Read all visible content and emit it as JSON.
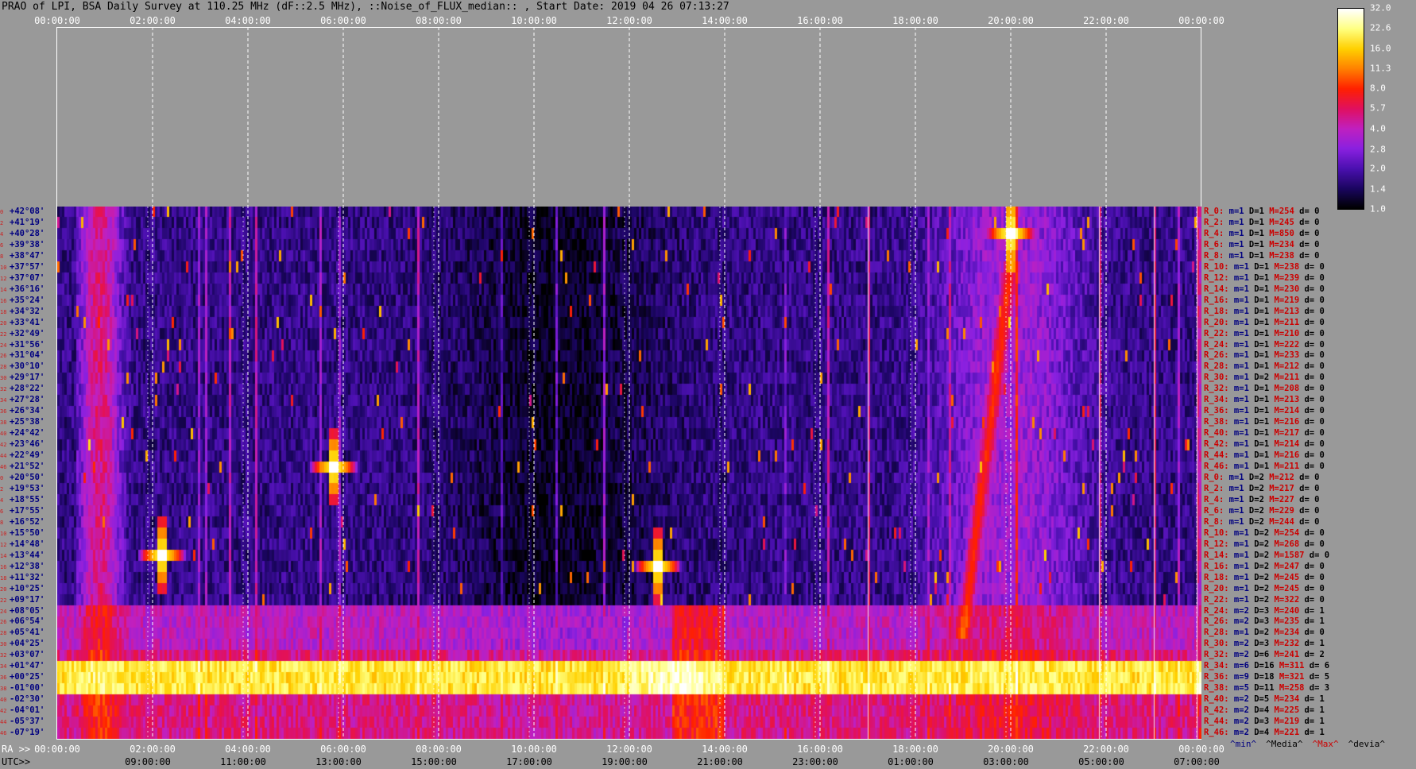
{
  "title": "PRAO of LPI, BSA Daily Survey at 110.25 MHz (dF::2.5 MHz), ::Noise_of_FLUX_median:: , Start Date: 2019 04 26 07:13:27",
  "top_ticks": [
    "00:00:00",
    "02:00:00",
    "04:00:00",
    "06:00:00",
    "08:00:00",
    "10:00:00",
    "12:00:00",
    "14:00:00",
    "16:00:00",
    "18:00:00",
    "20:00:00",
    "22:00:00",
    "00:00:00"
  ],
  "ra_label": "RA >>",
  "ra_ticks": [
    "00:00:00",
    "02:00:00",
    "04:00:00",
    "06:00:00",
    "08:00:00",
    "10:00:00",
    "12:00:00",
    "14:00:00",
    "16:00:00",
    "18:00:00",
    "20:00:00",
    "22:00:00",
    "00:00:00"
  ],
  "utc_label": "UTC>>",
  "utc_ticks": [
    "09:00:00",
    "11:00:00",
    "13:00:00",
    "15:00:00",
    "17:00:00",
    "19:00:00",
    "21:00:00",
    "23:00:00",
    "01:00:00",
    "03:00:00",
    "05:00:00",
    "07:00:00"
  ],
  "chart_data": {
    "type": "heatmap",
    "title": "PRAO of LPI, BSA Daily Survey at 110.25 MHz (dF::2.5 MHz), ::Noise_of_FLUX_median:: , Start Date: 2019 04 26 07:13:27",
    "x_axis": "RA / UTC, 24 h",
    "declinations": [
      "+42°08'",
      "+41°19'",
      "+40°28'",
      "+39°38'",
      "+38°47'",
      "+37°57'",
      "+37°07'",
      "+36°16'",
      "+35°24'",
      "+34°32'",
      "+33°41'",
      "+32°49'",
      "+31°56'",
      "+31°04'",
      "+30°10'",
      "+29°17'",
      "+28°22'",
      "+27°28'",
      "+26°34'",
      "+25°38'",
      "+24°42'",
      "+23°46'",
      "+22°49'",
      "+21°52'",
      "+20°50'",
      "+19°53'",
      "+18°55'",
      "+17°55'",
      "+16°52'",
      "+15°50'",
      "+14°48'",
      "+13°44'",
      "+12°38'",
      "+11°32'",
      "+10°25'",
      "+09°17'",
      "+08°05'",
      "+06°54'",
      "+05°41'",
      "+04°25'",
      "+03°07'",
      "+01°47'",
      "+00°25'",
      "-01°00'",
      "-02°30'",
      "-04°01'",
      "-05°37'",
      "-07°19'"
    ],
    "row_indices": [
      "0",
      "2",
      "4",
      "6",
      "8",
      "10",
      "12",
      "14",
      "16",
      "18",
      "20",
      "22",
      "24",
      "26",
      "28",
      "30",
      "32",
      "34",
      "36",
      "38",
      "40",
      "42",
      "44",
      "46",
      "0",
      "2",
      "4",
      "6",
      "8",
      "10",
      "12",
      "14",
      "16",
      "18",
      "20",
      "22",
      "24",
      "26",
      "28",
      "30",
      "32",
      "34",
      "36",
      "38",
      "40",
      "42",
      "44",
      "46"
    ],
    "colorbar": {
      "ticks": [
        "32.0",
        "22.6",
        "16.0",
        "11.3",
        "8.0",
        "5.7",
        "4.0",
        "2.8",
        "2.0",
        "1.4",
        "1.0"
      ],
      "min": 1.0,
      "max": 32.0,
      "scale": "log2",
      "colors": [
        "#000000",
        "#1a0560",
        "#4b10b0",
        "#8a20e0",
        "#c020c0",
        "#e01060",
        "#ff2000",
        "#ff8000",
        "#ffd000",
        "#ffff80",
        "#ffffff"
      ]
    },
    "stats": [
      {
        "r": "R_0:",
        "m": "1",
        "d": "1",
        "M": "254",
        "dv": "0"
      },
      {
        "r": "R_2:",
        "m": "1",
        "d": "1",
        "M": "245",
        "dv": "0"
      },
      {
        "r": "R_4:",
        "m": "1",
        "d": "1",
        "M": "850",
        "dv": "0"
      },
      {
        "r": "R_6:",
        "m": "1",
        "d": "1",
        "M": "234",
        "dv": "0"
      },
      {
        "r": "R_8:",
        "m": "1",
        "d": "1",
        "M": "238",
        "dv": "0"
      },
      {
        "r": "R_10:",
        "m": "1",
        "d": "1",
        "M": "238",
        "dv": "0"
      },
      {
        "r": "R_12:",
        "m": "1",
        "d": "1",
        "M": "239",
        "dv": "0"
      },
      {
        "r": "R_14:",
        "m": "1",
        "d": "1",
        "M": "230",
        "dv": "0"
      },
      {
        "r": "R_16:",
        "m": "1",
        "d": "1",
        "M": "219",
        "dv": "0"
      },
      {
        "r": "R_18:",
        "m": "1",
        "d": "1",
        "M": "213",
        "dv": "0"
      },
      {
        "r": "R_20:",
        "m": "1",
        "d": "1",
        "M": "211",
        "dv": "0"
      },
      {
        "r": "R_22:",
        "m": "1",
        "d": "1",
        "M": "210",
        "dv": "0"
      },
      {
        "r": "R_24:",
        "m": "1",
        "d": "1",
        "M": "222",
        "dv": "0"
      },
      {
        "r": "R_26:",
        "m": "1",
        "d": "1",
        "M": "233",
        "dv": "0"
      },
      {
        "r": "R_28:",
        "m": "1",
        "d": "1",
        "M": "212",
        "dv": "0"
      },
      {
        "r": "R_30:",
        "m": "1",
        "d": "2",
        "M": "211",
        "dv": "0"
      },
      {
        "r": "R_32:",
        "m": "1",
        "d": "1",
        "M": "208",
        "dv": "0"
      },
      {
        "r": "R_34:",
        "m": "1",
        "d": "1",
        "M": "213",
        "dv": "0"
      },
      {
        "r": "R_36:",
        "m": "1",
        "d": "1",
        "M": "214",
        "dv": "0"
      },
      {
        "r": "R_38:",
        "m": "1",
        "d": "1",
        "M": "216",
        "dv": "0"
      },
      {
        "r": "R_40:",
        "m": "1",
        "d": "1",
        "M": "217",
        "dv": "0"
      },
      {
        "r": "R_42:",
        "m": "1",
        "d": "1",
        "M": "214",
        "dv": "0"
      },
      {
        "r": "R_44:",
        "m": "1",
        "d": "1",
        "M": "216",
        "dv": "0"
      },
      {
        "r": "R_46:",
        "m": "1",
        "d": "1",
        "M": "211",
        "dv": "0"
      },
      {
        "r": "R_0:",
        "m": "1",
        "d": "2",
        "M": "212",
        "dv": "0"
      },
      {
        "r": "R_2:",
        "m": "1",
        "d": "2",
        "M": "217",
        "dv": "0"
      },
      {
        "r": "R_4:",
        "m": "1",
        "d": "2",
        "M": "227",
        "dv": "0"
      },
      {
        "r": "R_6:",
        "m": "1",
        "d": "2",
        "M": "229",
        "dv": "0"
      },
      {
        "r": "R_8:",
        "m": "1",
        "d": "2",
        "M": "244",
        "dv": "0"
      },
      {
        "r": "R_10:",
        "m": "1",
        "d": "2",
        "M": "254",
        "dv": "0"
      },
      {
        "r": "R_12:",
        "m": "1",
        "d": "2",
        "M": "268",
        "dv": "0"
      },
      {
        "r": "R_14:",
        "m": "1",
        "d": "2",
        "M": "1587",
        "dv": "0"
      },
      {
        "r": "R_16:",
        "m": "1",
        "d": "2",
        "M": "247",
        "dv": "0"
      },
      {
        "r": "R_18:",
        "m": "1",
        "d": "2",
        "M": "245",
        "dv": "0"
      },
      {
        "r": "R_20:",
        "m": "1",
        "d": "2",
        "M": "245",
        "dv": "0"
      },
      {
        "r": "R_22:",
        "m": "1",
        "d": "2",
        "M": "322",
        "dv": "0"
      },
      {
        "r": "R_24:",
        "m": "2",
        "d": "3",
        "M": "240",
        "dv": "1"
      },
      {
        "r": "R_26:",
        "m": "2",
        "d": "3",
        "M": "235",
        "dv": "1"
      },
      {
        "r": "R_28:",
        "m": "1",
        "d": "2",
        "M": "234",
        "dv": "0"
      },
      {
        "r": "R_30:",
        "m": "2",
        "d": "3",
        "M": "232",
        "dv": "1"
      },
      {
        "r": "R_32:",
        "m": "2",
        "d": "6",
        "M": "241",
        "dv": "2"
      },
      {
        "r": "R_34:",
        "m": "6",
        "d": "16",
        "M": "311",
        "dv": "6"
      },
      {
        "r": "R_36:",
        "m": "9",
        "d": "18",
        "M": "321",
        "dv": "5"
      },
      {
        "r": "R_38:",
        "m": "5",
        "d": "11",
        "M": "258",
        "dv": "3"
      },
      {
        "r": "R_40:",
        "m": "2",
        "d": "5",
        "M": "234",
        "dv": "1"
      },
      {
        "r": "R_42:",
        "m": "2",
        "d": "4",
        "M": "225",
        "dv": "1"
      },
      {
        "r": "R_44:",
        "m": "2",
        "d": "3",
        "M": "219",
        "dv": "1"
      },
      {
        "r": "R_46:",
        "m": "2",
        "d": "4",
        "M": "221",
        "dv": "1"
      }
    ],
    "stat_legend": [
      "^min^",
      "^Media^",
      "^Max^",
      "^devia^"
    ],
    "stat_legend_colors": [
      "#000080",
      "#000000",
      "#cc0000",
      "#000000"
    ],
    "features": {
      "bright_band_dec_rows": [
        41,
        42,
        43
      ],
      "elevated_band_from_row": 36,
      "point_sources": [
        {
          "ra_h": 20.0,
          "row": 2
        },
        {
          "ra_h": 2.2,
          "row": 31
        },
        {
          "ra_h": 5.8,
          "row": 23
        },
        {
          "ra_h": 12.6,
          "row": 32
        }
      ],
      "drifting_arc": {
        "ra_start_h": 20.0,
        "ra_end_h": 19.0,
        "row_start": 5,
        "row_end": 38
      }
    }
  }
}
